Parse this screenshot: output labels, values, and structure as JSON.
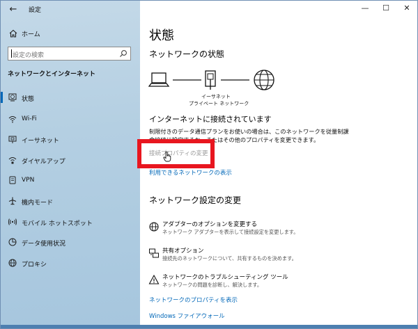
{
  "window": {
    "back_symbol": "←",
    "title": "設定",
    "controls": [
      "—",
      "☐",
      "✕"
    ]
  },
  "sidebar": {
    "home_label": "ホーム",
    "search_placeholder": "設定の検索",
    "section_heading": "ネットワークとインターネット",
    "items": [
      {
        "label": "状態",
        "icon": "globe-status-icon",
        "selected": true
      },
      {
        "label": "Wi-Fi",
        "icon": "wifi-icon",
        "selected": false
      },
      {
        "label": "イーサネット",
        "icon": "ethernet-icon",
        "selected": false
      },
      {
        "label": "ダイヤルアップ",
        "icon": "dialup-icon",
        "selected": false
      },
      {
        "label": "VPN",
        "icon": "vpn-icon",
        "selected": false
      },
      {
        "label": "機内モード",
        "icon": "airplane-icon",
        "selected": false
      },
      {
        "label": "モバイル ホットスポット",
        "icon": "hotspot-icon",
        "selected": false
      },
      {
        "label": "データ使用状況",
        "icon": "data-usage-icon",
        "selected": false
      },
      {
        "label": "プロキシ",
        "icon": "proxy-globe-icon",
        "selected": false
      }
    ]
  },
  "main": {
    "title": "状態",
    "network_status_heading": "ネットワークの状態",
    "diagram": {
      "adapter_name": "イーサネット",
      "network_name": "プライベート ネットワーク"
    },
    "connected_text": "インターネットに接続されています",
    "description_lines": [
      "制限付きのデータ通信プランをお使いの場合は、このネットワークを従量制課",
      "金接続に設定するか、またはその他のプロパティを変更できます。"
    ],
    "change_properties_link": "接続プロパティの変更",
    "show_networks_link": "利用できるネットワークの表示",
    "change_settings_heading": "ネットワーク設定の変更",
    "options": [
      {
        "title": "アダプターのオプションを変更する",
        "desc": "ネットワーク アダプターを表示して接続設定を変更します。",
        "icon": "adapter-globe-icon"
      },
      {
        "title": "共有オプション",
        "desc": "接続先のネットワークについて、共有するものを決めます。",
        "icon": "sharing-icon"
      },
      {
        "title": "ネットワークのトラブルシューティング ツール",
        "desc": "ネットワークの問題を診断し、解決します。",
        "icon": "warning-icon"
      }
    ],
    "network_properties_link": "ネットワークのプロパティを表示",
    "firewall_link": "Windows ファイアウォール"
  },
  "colors": {
    "accent": "#0067b8",
    "highlight_box": "#e8161f",
    "sidebar_bg": "#b4cfe2"
  }
}
